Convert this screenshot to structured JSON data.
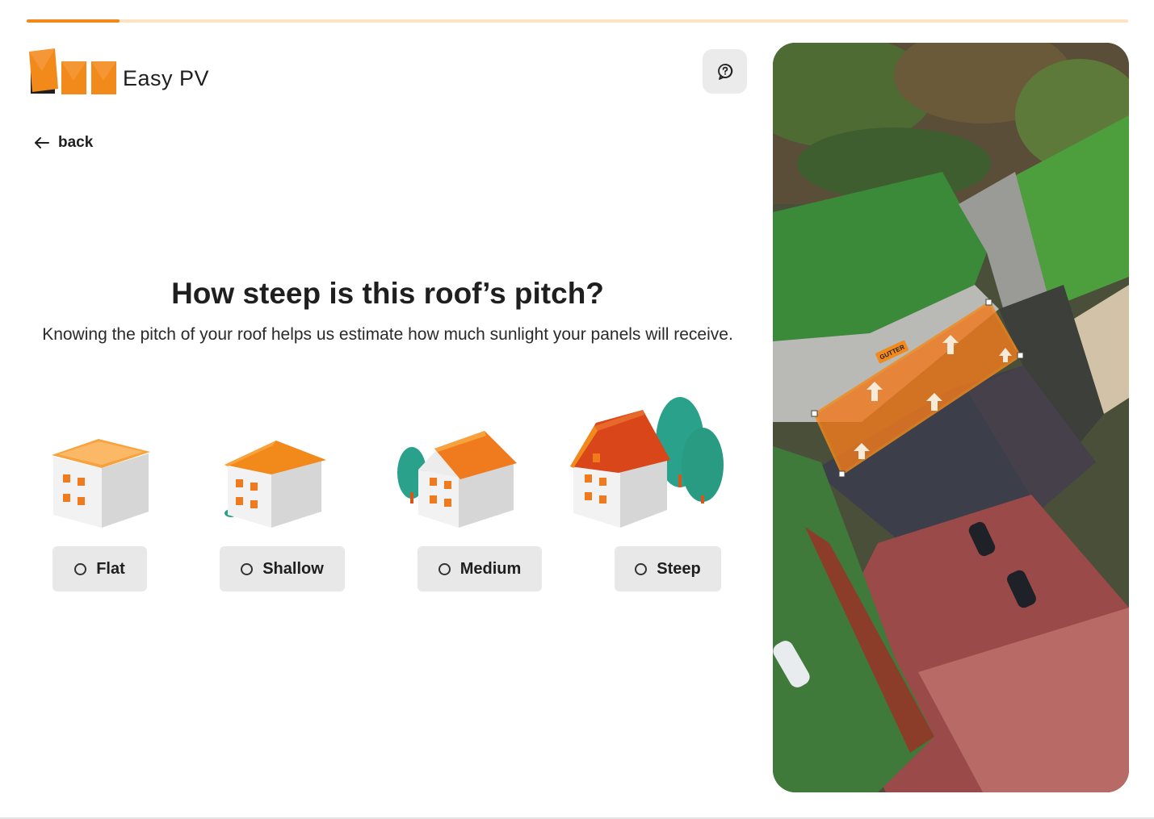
{
  "app": {
    "name": "Easy PV"
  },
  "progress": {
    "fraction": 0.084
  },
  "nav": {
    "back_label": "back"
  },
  "question": {
    "title": "How steep is this roof’s pitch?",
    "description": "Knowing the pitch of your roof helps us estimate how much sunlight your panels will receive."
  },
  "options": [
    {
      "label": "Flat",
      "icon": "flat-roof-house-icon",
      "selected": false
    },
    {
      "label": "Shallow",
      "icon": "shallow-roof-house-icon",
      "selected": false
    },
    {
      "label": "Medium",
      "icon": "medium-roof-house-icon",
      "selected": false
    },
    {
      "label": "Steep",
      "icon": "steep-roof-house-icon",
      "selected": false
    }
  ],
  "map": {
    "marker_label": "GUTTER"
  },
  "colors": {
    "accent": "#f28a1b",
    "progress_track": "#fbe3c4",
    "button_bg": "#e8e8e8",
    "roof_highlight": "#f07a1e"
  }
}
